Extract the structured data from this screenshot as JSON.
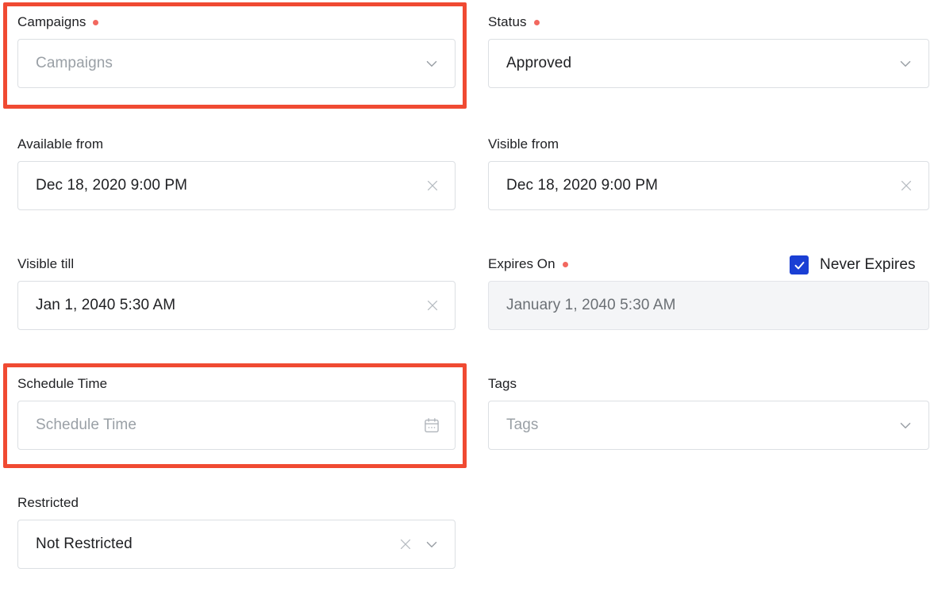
{
  "form": {
    "fields": [
      {
        "key": "campaigns",
        "label": "Campaigns",
        "required": true,
        "value": "",
        "placeholder": "Campaigns",
        "control": "select",
        "disabled": false,
        "highlighted": true
      },
      {
        "key": "status",
        "label": "Status",
        "required": true,
        "value": "Approved",
        "placeholder": "Status",
        "control": "select",
        "disabled": false,
        "highlighted": false
      },
      {
        "key": "available_from",
        "label": "Available from",
        "required": false,
        "value": "Dec 18, 2020 9:00 PM",
        "placeholder": "Available from",
        "control": "clearable",
        "disabled": false,
        "highlighted": false
      },
      {
        "key": "visible_from",
        "label": "Visible from",
        "required": false,
        "value": "Dec 18, 2020 9:00 PM",
        "placeholder": "Visible from",
        "control": "clearable",
        "disabled": false,
        "highlighted": false
      },
      {
        "key": "visible_till",
        "label": "Visible till",
        "required": false,
        "value": "Jan 1, 2040 5:30 AM",
        "placeholder": "Visible till",
        "control": "clearable",
        "disabled": false,
        "highlighted": false
      },
      {
        "key": "expires_on",
        "label": "Expires On",
        "required": true,
        "value": "January 1, 2040 5:30 AM",
        "placeholder": "Expires On",
        "control": "plain",
        "disabled": true,
        "highlighted": false
      },
      {
        "key": "schedule_time",
        "label": "Schedule Time",
        "required": false,
        "value": "",
        "placeholder": "Schedule Time",
        "control": "datepicker",
        "disabled": false,
        "highlighted": true
      },
      {
        "key": "tags",
        "label": "Tags",
        "required": false,
        "value": "",
        "placeholder": "Tags",
        "control": "select",
        "disabled": false,
        "highlighted": false
      },
      {
        "key": "restricted",
        "label": "Restricted",
        "required": false,
        "value": "Not Restricted",
        "placeholder": "Restricted",
        "control": "clearable-select",
        "disabled": false,
        "highlighted": false
      }
    ],
    "never_expires": {
      "label": "Never Expires",
      "checked": true
    },
    "icons": {
      "chevron": "chevron-down-icon",
      "clear": "clear-x-icon",
      "calendar": "calendar-icon",
      "check": "check-icon",
      "required": "required-dot-icon"
    },
    "colors": {
      "required_dot": "#f2685f",
      "checkbox": "#1a3fd4",
      "highlight_border": "#f04a32",
      "border": "#dcdfe3",
      "disabled_bg": "#f4f5f7",
      "text": "#202124",
      "placeholder": "#9aa0a6"
    }
  }
}
